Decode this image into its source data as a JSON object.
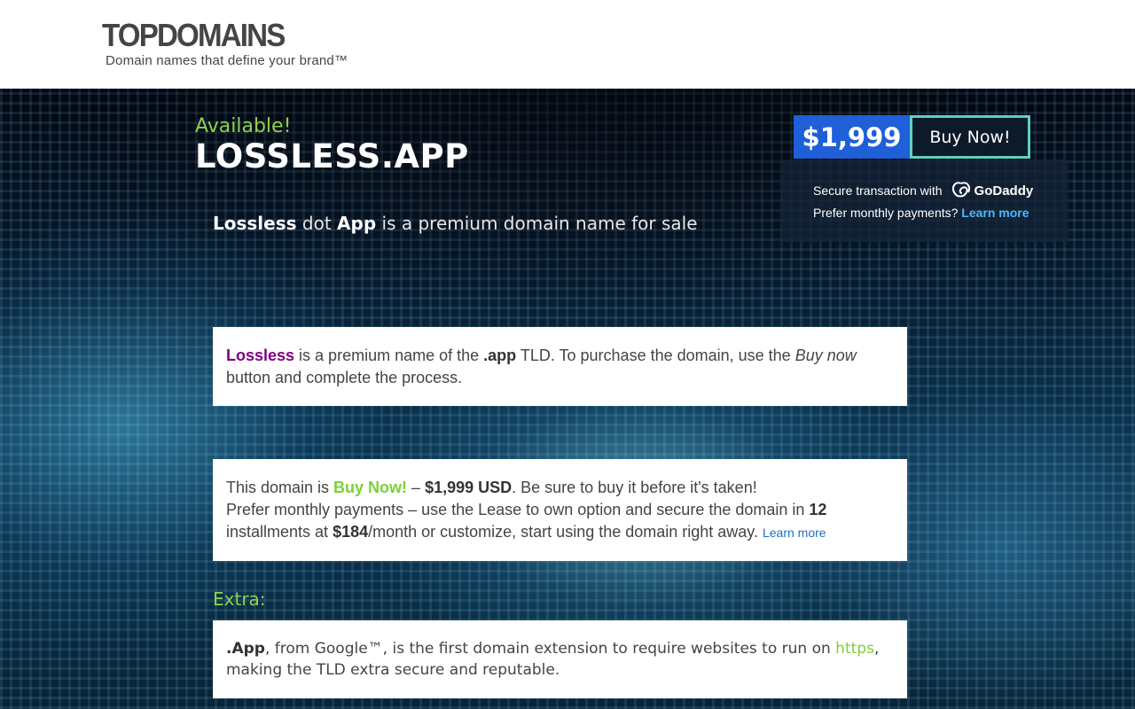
{
  "header": {
    "logo": "TOPDOMAINS",
    "tagline": "Domain names that define your brand™"
  },
  "hero": {
    "available": "Available!",
    "domain": "LOSSLESS.APP",
    "subtitle": {
      "word1": "Lossless",
      "dot": " dot ",
      "word2": "App",
      "rest": " is a premium domain name for sale"
    }
  },
  "buybox": {
    "price": "$1,999",
    "buy_label": "Buy Now!",
    "secure_text": "Secure transaction with",
    "godaddy_label": "GoDaddy",
    "monthly_text": "Prefer monthly payments?",
    "learn_more": "Learn more"
  },
  "card1": {
    "name": "Lossless",
    "t1": " is a premium name of the ",
    "tld": ".app",
    "t2": " TLD. To purchase the domain, use the ",
    "buy_now_italic": "Buy now",
    "t3": " button and complete the process."
  },
  "card2": {
    "t1": "This domain is ",
    "buy_now": "Buy Now!",
    "dash": " – ",
    "price": "$1,999 USD",
    "t2": ". Be sure to buy it before it's taken!",
    "t3": "Prefer monthly payments – use the Lease to own option and secure the domain in ",
    "installments": "12",
    "t4": " installments at ",
    "monthly_price": "$184",
    "t5": "/month or customize, start using the domain right away. ",
    "learn_more": "Learn more"
  },
  "extra": {
    "heading": "Extra:",
    "tld": ".App",
    "t1": ", from Google™, is the first domain extension to require websites to run on ",
    "https": "https",
    "t2": ", making the TLD extra secure and reputable."
  },
  "colors": {
    "accent_green": "#8fd14f",
    "price_blue": "#1f5fd8",
    "buy_border": "#5fd0c0",
    "link_blue": "#4fb7ff",
    "purple": "#800080"
  }
}
